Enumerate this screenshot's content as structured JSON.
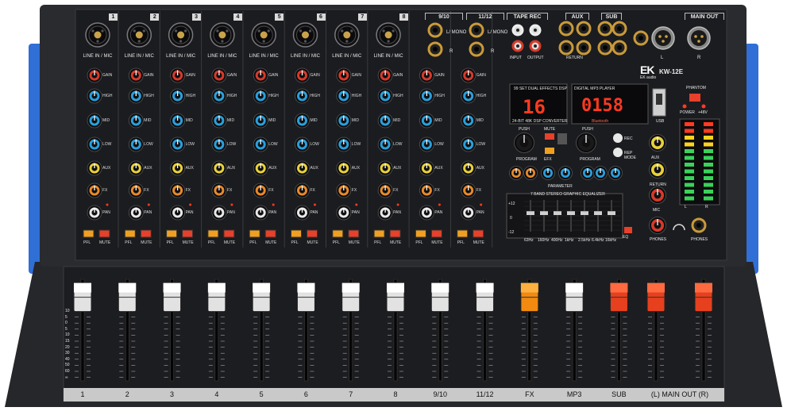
{
  "brand": {
    "logo_letters": "EK",
    "logo_sub": "EK audio",
    "model": "KW-12E"
  },
  "channels": [
    {
      "label": "1",
      "number": "1",
      "input_label": "LINE IN / MIC"
    },
    {
      "label": "2",
      "number": "2",
      "input_label": "LINE IN / MIC"
    },
    {
      "label": "3",
      "number": "3",
      "input_label": "LINE IN / MIC"
    },
    {
      "label": "4",
      "number": "4",
      "input_label": "LINE IN / MIC"
    },
    {
      "label": "5",
      "number": "5",
      "input_label": "LINE IN / MIC"
    },
    {
      "label": "6",
      "number": "6",
      "input_label": "LINE IN / MIC"
    },
    {
      "label": "7",
      "number": "7",
      "input_label": "LINE IN / MIC"
    },
    {
      "label": "8",
      "number": "8",
      "input_label": "LINE IN / MIC"
    },
    {
      "label": "9/10",
      "number": "9/10",
      "input_label": ""
    },
    {
      "label": "11/12",
      "number": "11/12",
      "input_label": ""
    }
  ],
  "stereo_jack_labels": {
    "l_mono": "L/ MONO",
    "r": "R"
  },
  "sections": {
    "tape_rec": "TAPE REC",
    "aux": "AUX",
    "sub": "SUB",
    "main_out": "MAIN OUT",
    "input": "INPUT",
    "output": "OUTPUT",
    "return": "RETURN",
    "main_l": "L",
    "main_r": "R"
  },
  "channel_controls": {
    "gain": "GAIN",
    "high": "HIGH",
    "mid": "MID",
    "low": "LOW",
    "aux": "AUX",
    "fx": "FX",
    "pan": "PAN",
    "pfl": "PFL",
    "mute": "MUTE"
  },
  "dsp": {
    "title": "99 SET DUAL EFFECTS DSP",
    "display_value": "16",
    "sub_label": "24-BIT 48K DSP CONVERTER",
    "program": "PROGRAM",
    "parameter": "PARAMETER",
    "push": "PUSH",
    "mute": "MUTE",
    "efx": "EFX"
  },
  "mp3": {
    "title": "DIGITAL MP3 PLAYER",
    "display_value": "0158",
    "bluetooth": "Bluetooth",
    "usb": "USB",
    "rec": "REC",
    "rep": "REP",
    "mode": "MODE"
  },
  "master": {
    "phantom": "PHANTOM",
    "power": "POWER",
    "v48": "+48V",
    "aux": "AUX",
    "return": "RETURN",
    "mic": "MIC",
    "phones": "PHONES",
    "phones_jack": "PHONES",
    "meter_l": "L",
    "meter_r": "R",
    "eq_label": "EQ"
  },
  "geq": {
    "title": "7 BAND STEREO GRAPHIC EQUALIZER",
    "bands": [
      "63Hz",
      "160Hz",
      "400Hz",
      "1kHz",
      "2.5kHz",
      "6.4kHz",
      "16kHz"
    ],
    "db_top": "+12",
    "db_mid": "0",
    "db_bottom": "-12"
  },
  "faders": [
    {
      "label": "1",
      "cap": "white",
      "level": 0.95
    },
    {
      "label": "2",
      "cap": "white",
      "level": 0.95
    },
    {
      "label": "3",
      "cap": "white",
      "level": 0.95
    },
    {
      "label": "4",
      "cap": "white",
      "level": 0.95
    },
    {
      "label": "5",
      "cap": "white",
      "level": 0.95
    },
    {
      "label": "6",
      "cap": "white",
      "level": 0.95
    },
    {
      "label": "7",
      "cap": "white",
      "level": 0.95
    },
    {
      "label": "8",
      "cap": "white",
      "level": 0.95
    },
    {
      "label": "9/10",
      "cap": "white",
      "level": 0.95
    },
    {
      "label": "11/12",
      "cap": "white",
      "level": 0.95
    },
    {
      "label": "FX",
      "cap": "orange",
      "level": 0.95
    },
    {
      "label": "MP3",
      "cap": "white",
      "level": 0.95
    },
    {
      "label": "SUB",
      "cap": "red",
      "level": 0.95
    },
    {
      "label": "(L)",
      "cap": "red",
      "level": 0.95
    },
    {
      "label": "(R)",
      "cap": "red",
      "level": 0.95
    }
  ],
  "fader_scale": [
    "10",
    "5",
    "0",
    "5",
    "10",
    "15",
    "20",
    "30",
    "40",
    "50",
    "60",
    "∞"
  ],
  "bottom_labels": [
    "1",
    "2",
    "3",
    "4",
    "5",
    "6",
    "7",
    "8",
    "9/10",
    "11/12",
    "FX",
    "MP3",
    "SUB",
    "(L) MAIN OUT (R)"
  ],
  "colors": {
    "panel": "#1b1c1f",
    "frame": "#2a2b2e",
    "blue_trim": "#2f6fd6",
    "knob_red": "#d83a2a",
    "knob_blue": "#2aa0dc",
    "knob_yellow": "#e9d23a",
    "knob_orange": "#e88a2a",
    "knob_white": "#e8e8e8",
    "gold": "#c99a3a",
    "led_red": "#ff3a20",
    "led_green": "#39d25a",
    "led_yellow": "#ffd21e"
  }
}
